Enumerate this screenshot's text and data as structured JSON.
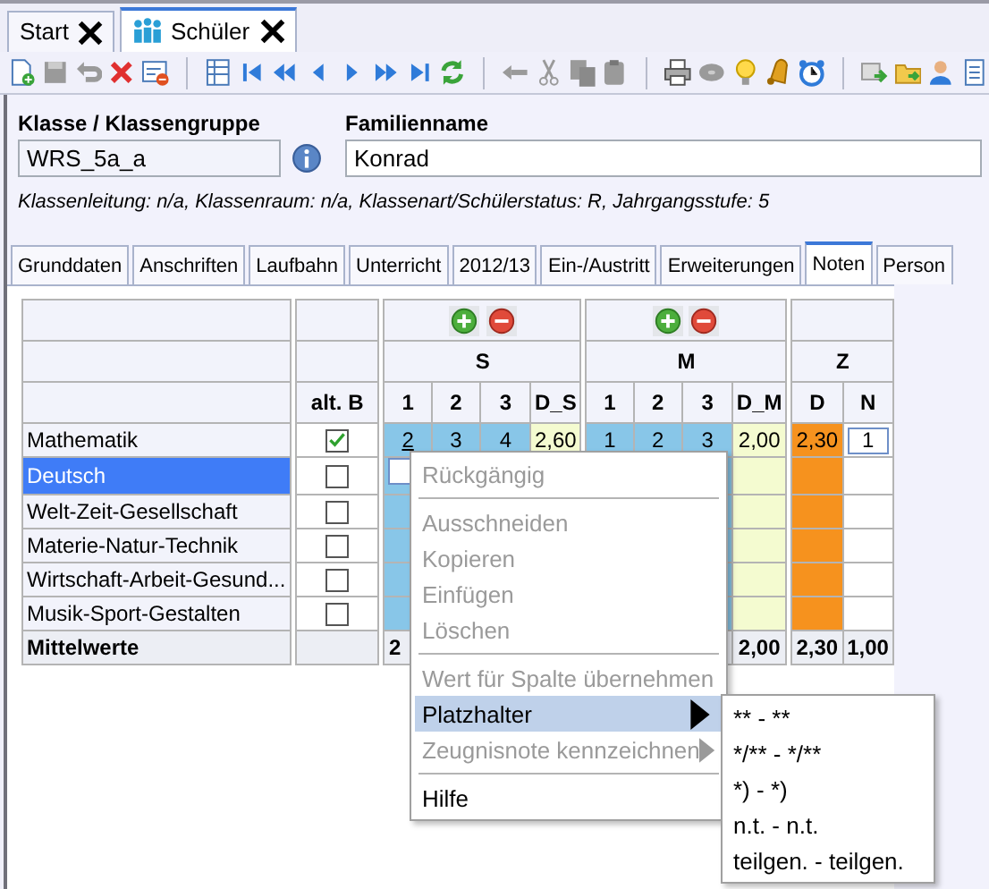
{
  "document_tabs": [
    {
      "label": "Start",
      "selected": false,
      "has_icon": false
    },
    {
      "label": "Schüler",
      "selected": true,
      "has_icon": true
    }
  ],
  "form": {
    "fields": [
      {
        "label": "Klasse / Klassengruppe",
        "value": "WRS_5a_a",
        "readonly": true,
        "info": true
      },
      {
        "label": "Familienname",
        "value": "Konrad",
        "readonly": false,
        "info": false
      }
    ],
    "info_line": "Klassenleitung: n/a, Klassenraum: n/a, Klassenart/Schülerstatus: R, Jahrgangsstufe: 5"
  },
  "tabs": [
    {
      "label": "Grunddaten",
      "selected": false
    },
    {
      "label": "Anschriften",
      "selected": false
    },
    {
      "label": "Laufbahn",
      "selected": false
    },
    {
      "label": "Unterricht",
      "selected": false
    },
    {
      "label": "2012/13",
      "selected": false
    },
    {
      "label": "Ein-/Austritt",
      "selected": false
    },
    {
      "label": "Erweiterungen",
      "selected": false
    },
    {
      "label": "Noten",
      "selected": true
    },
    {
      "label": "Person",
      "selected": false
    }
  ],
  "grades": {
    "alt_b_heading": "alt. B",
    "groups": [
      {
        "label": "S",
        "buttons": true,
        "columns": [
          {
            "label": "1",
            "kind": "grade"
          },
          {
            "label": "2",
            "kind": "grade"
          },
          {
            "label": "3",
            "kind": "grade"
          },
          {
            "label": "D_S",
            "kind": "average"
          }
        ]
      },
      {
        "label": "M",
        "buttons": true,
        "columns": [
          {
            "label": "1",
            "kind": "grade"
          },
          {
            "label": "2",
            "kind": "grade"
          },
          {
            "label": "3",
            "kind": "grade"
          },
          {
            "label": "D_M",
            "kind": "average"
          }
        ]
      },
      {
        "label": "Z",
        "buttons": false,
        "columns": [
          {
            "label": "D",
            "kind": "final"
          },
          {
            "label": "N",
            "kind": "plain"
          }
        ]
      }
    ],
    "rows": [
      {
        "name": "Mathematik",
        "selected": false,
        "alt_b": true,
        "cells": [
          {
            "text": "2",
            "underlined": true
          },
          "3",
          "4",
          "2,60",
          "1",
          "2",
          "3",
          "2,00",
          "2,30",
          {
            "text": "1",
            "editing": true
          }
        ]
      },
      {
        "name": "Deutsch",
        "selected": true,
        "alt_b": false,
        "cells": [
          {
            "editing": true
          }
        ]
      },
      {
        "name": "Welt-Zeit-Gesellschaft",
        "selected": false,
        "alt_b": false
      },
      {
        "name": "Materie-Natur-Technik",
        "selected": false,
        "alt_b": false
      },
      {
        "name": "Wirtschaft-Arbeit-Gesund...",
        "selected": false,
        "alt_b": false
      },
      {
        "name": "Musik-Sport-Gestalten",
        "selected": false,
        "alt_b": false
      }
    ],
    "summary": {
      "label": "Mittelwerte",
      "cells": [
        "2",
        null,
        null,
        null,
        null,
        null,
        null,
        "2,00",
        "2,30",
        "1,00"
      ]
    }
  },
  "context_menu": {
    "items": [
      {
        "kind": "item",
        "label": "Rückgängig",
        "disabled": true,
        "selected": false
      },
      {
        "kind": "separator"
      },
      {
        "kind": "item",
        "label": "Ausschneiden",
        "disabled": true,
        "selected": false
      },
      {
        "kind": "item",
        "label": "Kopieren",
        "disabled": true,
        "selected": false
      },
      {
        "kind": "item",
        "label": "Einfügen",
        "disabled": true,
        "selected": false
      },
      {
        "kind": "item",
        "label": "Löschen",
        "disabled": true,
        "selected": false
      },
      {
        "kind": "separator"
      },
      {
        "kind": "item",
        "label": "Wert für Spalte übernehmen",
        "disabled": true,
        "selected": false
      },
      {
        "kind": "item",
        "label": "Platzhalter",
        "disabled": false,
        "selected": true,
        "has_submenu": true,
        "expanded": true,
        "children": [
          {
            "label": "** - **"
          },
          {
            "label": "*/** - */**"
          },
          {
            "label": "*) - *)"
          },
          {
            "label": "n.t. - n.t."
          },
          {
            "label": "teilgen. - teilgen."
          }
        ]
      },
      {
        "kind": "item",
        "label": "Zeugnisnote kennzeichnen",
        "disabled": true,
        "selected": false,
        "has_submenu": true,
        "expanded": false
      },
      {
        "kind": "separator"
      },
      {
        "kind": "item",
        "label": "Hilfe",
        "disabled": false,
        "selected": false
      }
    ]
  }
}
